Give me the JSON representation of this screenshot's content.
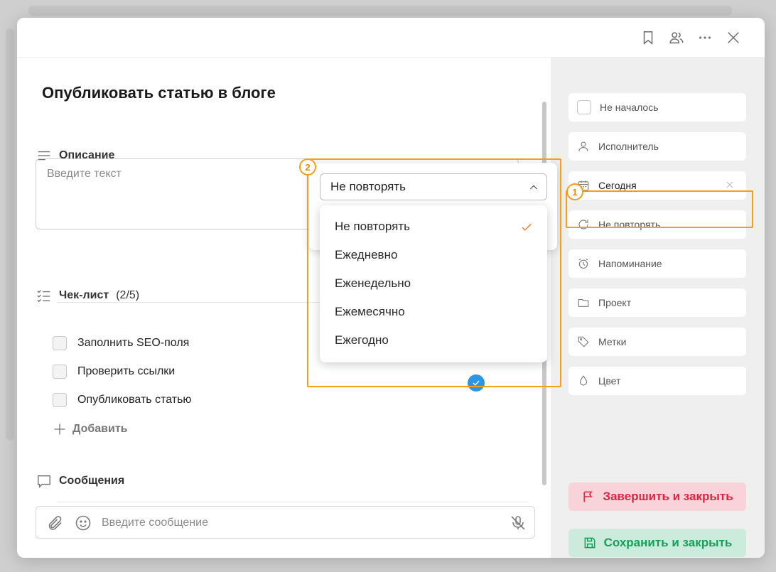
{
  "task": {
    "title": "Опубликовать статью в блоге"
  },
  "description": {
    "heading": "Описание",
    "placeholder": "Введите текст"
  },
  "checklist": {
    "heading": "Чек-лист",
    "count": "(2/5)",
    "items": [
      {
        "label": "Заполнить SEO-поля"
      },
      {
        "label": "Проверить ссылки"
      },
      {
        "label": "Опубликовать статью"
      }
    ],
    "add_label": "Добавить"
  },
  "messages": {
    "heading": "Сообщения",
    "placeholder": "Введите сообщение"
  },
  "sidebar": {
    "status": "Не началось",
    "assignee": "Исполнитель",
    "date": "Сегодня",
    "repeat": "Не повторять",
    "reminder": "Напоминание",
    "project": "Проект",
    "tags": "Метки",
    "color": "Цвет",
    "finish_button": "Завершить и закрыть",
    "save_button": "Сохранить и закрыть"
  },
  "repeat_popup": {
    "selected": "Не повторять",
    "options": [
      {
        "label": "Не повторять",
        "checked": true
      },
      {
        "label": "Ежедневно"
      },
      {
        "label": "Еженедельно"
      },
      {
        "label": "Ежемесячно"
      },
      {
        "label": "Ежегодно"
      }
    ]
  },
  "annotations": {
    "badge_1": "1",
    "badge_2": "2"
  },
  "colors": {
    "accent_orange": "#f59e16",
    "check_orange": "#f07a26",
    "finish_red": "#e2243f",
    "save_green": "#15a05a",
    "blue": "#2d95e6"
  }
}
